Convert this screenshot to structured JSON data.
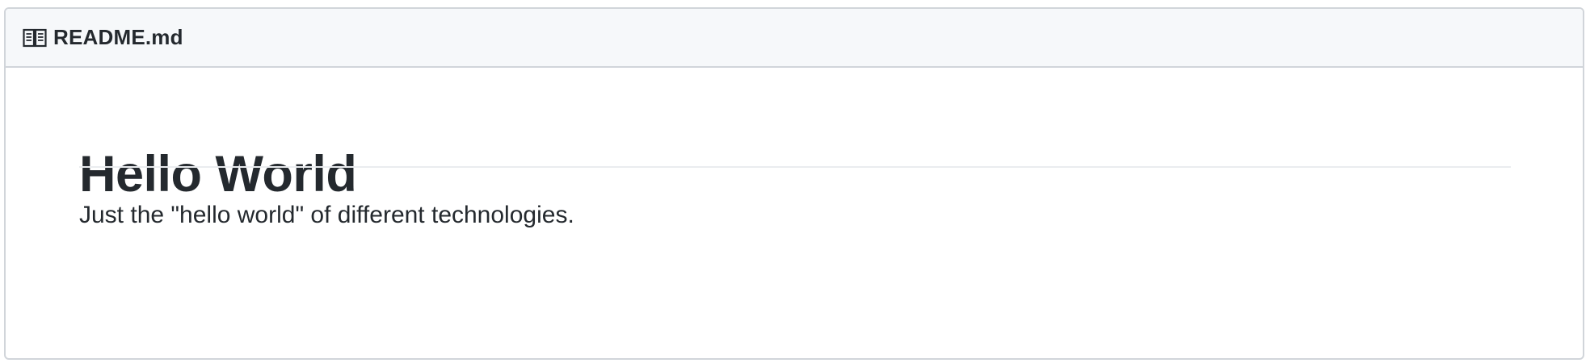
{
  "readme": {
    "filename": "README.md",
    "header_icon": "book-icon",
    "title": "Hello World",
    "description": "Just the \"hello world\" of different technologies."
  },
  "colors": {
    "header_background": "#f6f8fa",
    "border": "#d1d5da",
    "text": "#24292e",
    "rule": "#eaecef"
  }
}
